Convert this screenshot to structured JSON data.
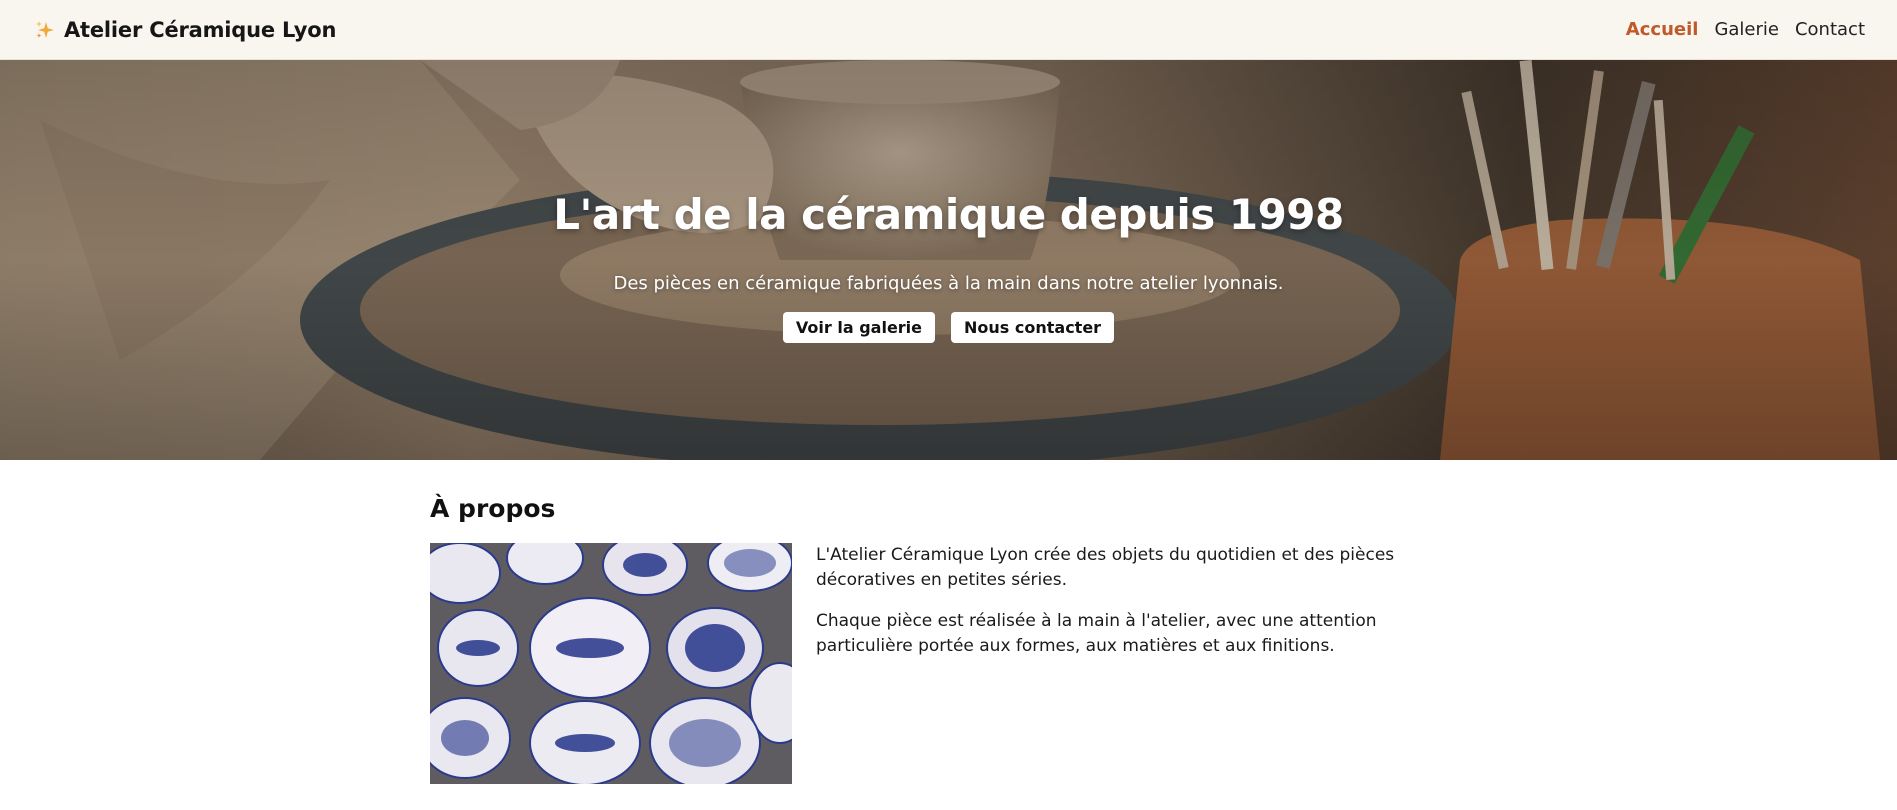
{
  "navbar": {
    "brand_icon": "sparkles-icon",
    "brand_name": "Atelier Céramique Lyon",
    "links": [
      {
        "label": "Accueil",
        "active": true
      },
      {
        "label": "Galerie",
        "active": false
      },
      {
        "label": "Contact",
        "active": false
      }
    ]
  },
  "hero": {
    "title": "L'art de la céramique depuis 1998",
    "subtitle": "Des pièces en céramique fabriquées à la main dans notre atelier lyonnais.",
    "buttons": {
      "gallery": "Voir la galerie",
      "contact": "Nous contacter"
    },
    "background_image": "pottery-wheel-photo"
  },
  "about": {
    "title": "À propos",
    "image": "blue-white-ceramic-bowls-photo",
    "paragraphs": [
      "L'Atelier Céramique Lyon crée des objets du quotidien et des pièces décoratives en petites séries.",
      "Chaque pièce est réalisée à la main à l'atelier, avec une attention particulière portée aux formes, aux matières et aux finitions."
    ]
  },
  "colors": {
    "accent": "#bf5a2b",
    "navbar_bg": "#f9f6f0",
    "button_bg": "#ffffff"
  }
}
